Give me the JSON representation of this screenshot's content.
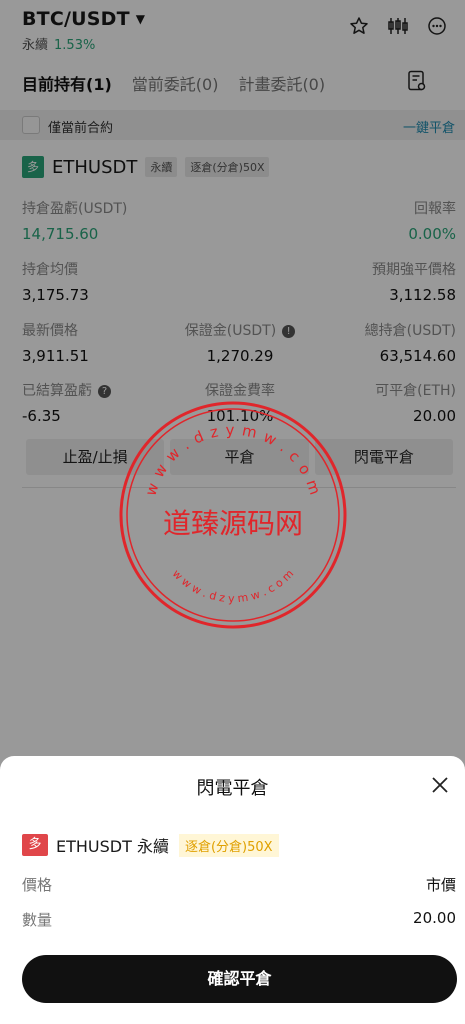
{
  "header": {
    "pair": "BTC/USDT",
    "market_type": "永續",
    "change": "1.53%"
  },
  "tabs": [
    {
      "label": "目前持有(1)"
    },
    {
      "label": "當前委託(0)"
    },
    {
      "label": "計畫委託(0)"
    }
  ],
  "filter": {
    "label": "僅當前合約",
    "close_all": "一鍵平倉"
  },
  "position": {
    "side_tag": "多",
    "symbol": "ETHUSDT",
    "type": "永續",
    "margin_mode": "逐倉(分倉)50X",
    "pnl_label": "持倉盈虧(USDT)",
    "pnl_value": "14,715.60",
    "roe_label": "回報率",
    "roe_value": "0.00%",
    "avg_label": "持倉均價",
    "avg_value": "3,175.73",
    "liq_label": "預期強平價格",
    "liq_value": "3,112.58",
    "last_label": "最新價格",
    "last_value": "3,911.51",
    "margin_label": "保證金(USDT)",
    "margin_value": "1,270.29",
    "total_label": "總持倉(USDT)",
    "total_value": "63,514.60",
    "realized_label": "已結算盈虧",
    "realized_value": "-6.35",
    "margin_rate_label": "保證金費率",
    "margin_rate_value": "101.10%",
    "closable_label": "可平倉(ETH)",
    "closable_value": "20.00",
    "btn_tpsl": "止盈/止損",
    "btn_close": "平倉",
    "btn_flash": "閃電平倉"
  },
  "watermark": {
    "text": "道臻源码网",
    "ring_top": "w w w . d z y m w . c o m",
    "ring_bottom": "w w w . d z y m w . c o m"
  },
  "sheet": {
    "title": "閃電平倉",
    "side_tag": "多",
    "product": "ETHUSDT 永續",
    "margin_mode": "逐倉(分倉)50X",
    "price_label": "價格",
    "price_value": "市價",
    "qty_label": "數量",
    "qty_value": "20.00",
    "confirm": "確認平倉"
  },
  "colors": {
    "green": "#2aa67a",
    "accent": "#1f8ab0",
    "red_tag": "#e0464a",
    "seal": "#e0262b"
  },
  "icons": [
    "caret-down-icon",
    "star-icon",
    "candlestick-icon",
    "more-icon",
    "order-doc-icon",
    "info-icon",
    "close-icon"
  ]
}
